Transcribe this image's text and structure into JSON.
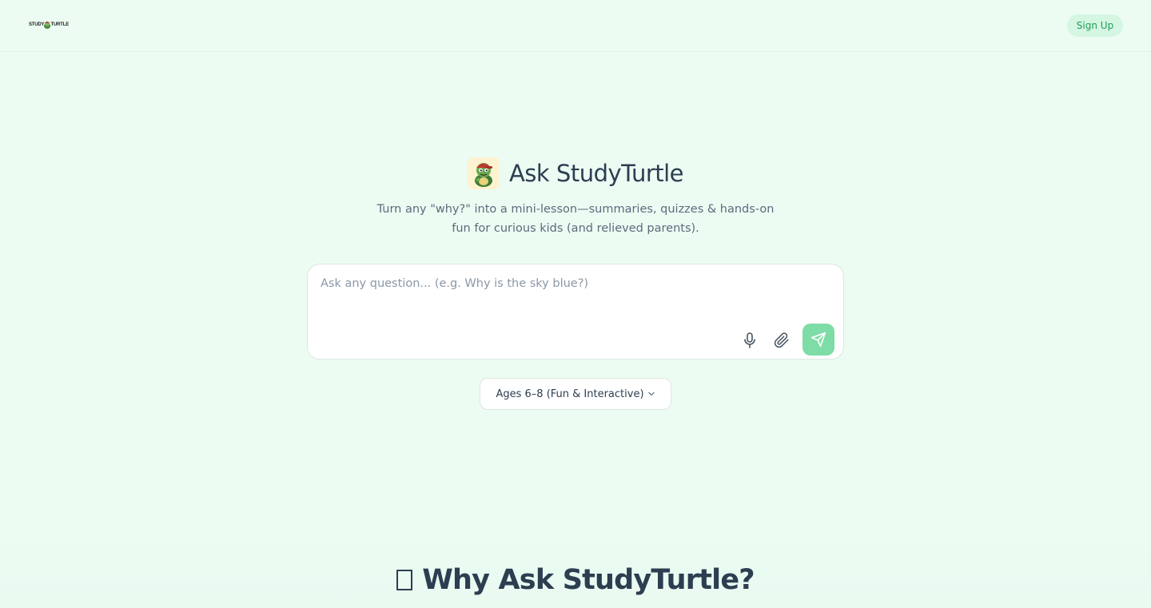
{
  "header": {
    "logo_left": "STUDY",
    "logo_right": "TURTLE",
    "signup_label": "Sign Up"
  },
  "hero": {
    "title": "Ask StudyTurtle",
    "subtitle": "Turn any \"why?\" into a mini-lesson—summaries, quizzes & hands-on fun for curious kids (and relieved parents)."
  },
  "ask": {
    "placeholder": "Ask any question... (e.g. Why is the sky blue?)",
    "value": ""
  },
  "age_select": {
    "selected": "Ages 6–8 (Fun & Interactive)"
  },
  "why_section": {
    "title": "Why Ask StudyTurtle?"
  },
  "colors": {
    "background": "#ecfcf3",
    "accent": "#7edca6",
    "signup_bg": "#d4f6e2",
    "signup_text": "#1f9d57",
    "heading": "#2c3e50"
  }
}
